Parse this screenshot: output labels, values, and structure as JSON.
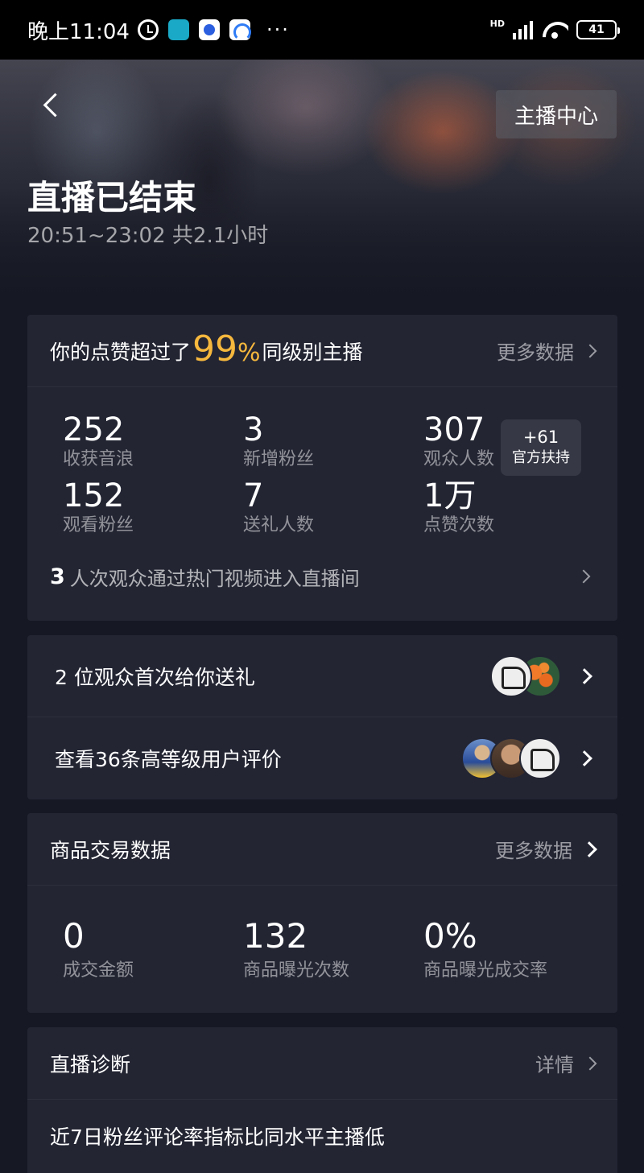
{
  "status_bar": {
    "time": "晚上11:04",
    "more": "···",
    "network": "HD",
    "battery": "41",
    "icons": [
      "alarm-icon",
      "app-icon",
      "baidu-icon",
      "browser-icon",
      "signal-icon",
      "wifi-icon",
      "battery-icon"
    ]
  },
  "header": {
    "back_icon": "back-arrow-icon",
    "center_button": "主播中心",
    "title": "直播已结束",
    "subtitle": "20:51~23:02 共2.1小时"
  },
  "summary": {
    "prefix": "你的点赞超过了",
    "percent_value": "99",
    "percent_sign": "%",
    "suffix": "同级别主播",
    "more_label": "更多数据",
    "stats": [
      {
        "value": "252",
        "label": "收获音浪"
      },
      {
        "value": "3",
        "label": "新增粉丝"
      },
      {
        "value": "307",
        "label": "观众人数"
      },
      {
        "value": "152",
        "label": "观看粉丝"
      },
      {
        "value": "7",
        "label": "送礼人数"
      },
      {
        "value": "1万",
        "label": "点赞次数"
      }
    ],
    "badge": {
      "value": "+61",
      "label": "官方扶持"
    },
    "hot_video": {
      "count": "3",
      "text": "人次观众通过热门视频进入直播间"
    }
  },
  "audience": {
    "first_gift": "2 位观众首次给你送礼",
    "reviews": "查看36条高等级用户评价"
  },
  "trade": {
    "title": "商品交易数据",
    "more_label": "更多数据",
    "stats": [
      {
        "value": "0",
        "label": "成交金额"
      },
      {
        "value": "132",
        "label": "商品曝光次数"
      },
      {
        "value": "0%",
        "label": "商品曝光成交率"
      }
    ]
  },
  "diagnosis": {
    "title": "直播诊断",
    "more_label": "详情",
    "item": "近7日粉丝评论率指标比同水平主播低"
  },
  "colors": {
    "background": "#161823",
    "card": "#232533",
    "accent": "#f6b83d"
  }
}
